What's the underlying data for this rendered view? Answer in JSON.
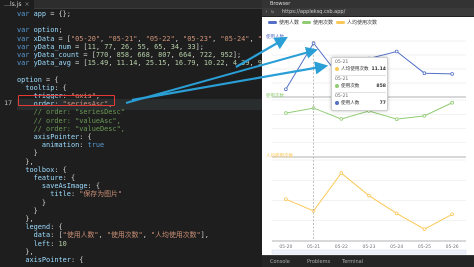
{
  "editor": {
    "tab_label": "…ls.js",
    "current_line": "17",
    "lines": [
      {
        "n": "",
        "html": "<span class=\"kw\">var</span> <span class=\"vr\">app</span> = {};"
      },
      {
        "n": "",
        "html": ""
      },
      {
        "n": "",
        "html": "<span class=\"kw\">var</span> <span class=\"vr\">option</span>;"
      },
      {
        "n": "",
        "html": "<span class=\"kw\">var</span> <span class=\"vr\">xData</span> = [<span class=\"st\">\"05-20\"</span>, <span class=\"st\">\"05-21\"</span>, <span class=\"st\">\"05-22\"</span>, <span class=\"st\">\"05-23\"</span>, <span class=\"st\">\"05-24\"</span>, <span class=\"st\">\"05-25\"</span>, <span class=\"st\">\"05-26\"</span>];"
      },
      {
        "n": "",
        "html": "<span class=\"kw\">var</span> <span class=\"vr\">yData_num</span> = [<span class=\"nm\">11</span>, <span class=\"nm\">77</span>, <span class=\"nm\">26</span>, <span class=\"nm\">55</span>, <span class=\"nm\">65</span>, <span class=\"nm\">34</span>, <span class=\"nm\">33</span>];"
      },
      {
        "n": "",
        "html": "<span class=\"kw\">var</span> <span class=\"vr\">yData_count</span> = [<span class=\"nm\">770</span>, <span class=\"nm\">858</span>, <span class=\"nm\">668</span>, <span class=\"nm\">807</span>, <span class=\"nm\">664</span>, <span class=\"nm\">722</span>, <span class=\"nm\">952</span>];"
      },
      {
        "n": "",
        "html": "<span class=\"kw\">var</span> <span class=\"vr\">yData_avg</span> = [<span class=\"nm\">15.49</span>, <span class=\"nm\">11.14</span>, <span class=\"nm\">25.15</span>, <span class=\"nm\">16.79</span>, <span class=\"nm\">10.22</span>, <span class=\"nm\">4.39</span>, <span class=\"nm\">9.9</span>];"
      },
      {
        "n": "",
        "html": ""
      },
      {
        "n": "",
        "html": "<span class=\"vr\">option</span> = {"
      },
      {
        "n": "",
        "html": "  <span class=\"vr\">tooltip</span>: {"
      },
      {
        "n": "",
        "html": "    <span class=\"vr\">trigger</span>: <span class=\"st\">\"axis\"</span>,"
      },
      {
        "n": "17",
        "html": "    <span class=\"vr\">order</span>: <span class=\"st\">\"seriesAsc\"</span>,",
        "hl": true
      },
      {
        "n": "",
        "html": "    <span class=\"cm\">// order: \"seriesDesc\"</span>"
      },
      {
        "n": "",
        "html": "    <span class=\"cm\">// order: \"valueAsc\",</span>"
      },
      {
        "n": "",
        "html": "    <span class=\"cm\">// order: \"valueDesc\",</span>"
      },
      {
        "n": "",
        "html": "    <span class=\"vr\">axisPointer</span>: {"
      },
      {
        "n": "",
        "html": "      <span class=\"vr\">animation</span>: <span class=\"bl\">true</span>"
      },
      {
        "n": "",
        "html": "    }"
      },
      {
        "n": "",
        "html": "  },"
      },
      {
        "n": "",
        "html": "  <span class=\"vr\">toolbox</span>: {"
      },
      {
        "n": "",
        "html": "    <span class=\"vr\">feature</span>: {"
      },
      {
        "n": "",
        "html": "      <span class=\"vr\">saveAsImage</span>: {"
      },
      {
        "n": "",
        "html": "        <span class=\"vr\">title</span>: <span class=\"st\">\"保存为图片\"</span>"
      },
      {
        "n": "",
        "html": "      }"
      },
      {
        "n": "",
        "html": "    }"
      },
      {
        "n": "",
        "html": "  },"
      },
      {
        "n": "",
        "html": "  <span class=\"vr\">legend</span>: {"
      },
      {
        "n": "",
        "html": "    <span class=\"vr\">data</span>: [<span class=\"st\">\"使用人数\"</span>, <span class=\"st\">\"使用次数\"</span>, <span class=\"st\">\"人均使用次数\"</span>],"
      },
      {
        "n": "",
        "html": "    <span class=\"vr\">left</span>: <span class=\"nm\">10</span>"
      },
      {
        "n": "",
        "html": "  },"
      },
      {
        "n": "",
        "html": "  <span class=\"vr\">axisPointer</span>: {"
      }
    ]
  },
  "browser": {
    "panel_title": "Browser",
    "url": "https://appleksq.csb.app/",
    "status_left": "Console",
    "status_mid": "Problems",
    "status_right": "Terminal"
  },
  "chart_data": [
    {
      "type": "line",
      "legend": [
        "使用人数",
        "使用次数",
        "人均使用次数"
      ],
      "categories": [
        "05-20",
        "05-21",
        "05-22",
        "05-23",
        "05-24",
        "05-25",
        "05-26"
      ],
      "grids": [
        {
          "title": "使用人数",
          "series": "使用人数",
          "values": [
            11,
            77,
            26,
            55,
            65,
            34,
            33
          ],
          "ylim": [
            0,
            80
          ],
          "color": "#5470c6"
        },
        {
          "title": "使用次数",
          "series": "使用次数",
          "values": [
            770,
            858,
            668,
            807,
            664,
            722,
            952
          ],
          "ylim": [
            0,
            1000
          ],
          "color": "#91cc75"
        },
        {
          "title": "人均使用次数",
          "series": "人均使用次数",
          "values": [
            15.49,
            11.14,
            25.15,
            16.79,
            10.22,
            4.39,
            9.9
          ],
          "ylim": [
            0,
            30
          ],
          "color": "#fac858"
        }
      ]
    }
  ],
  "tooltip": {
    "rows": [
      {
        "date": "05-21",
        "name": "人均使用次数",
        "value": "11.14",
        "color": "#fac858"
      },
      {
        "date": "05-21",
        "name": "使用次数",
        "value": "858",
        "color": "#91cc75"
      },
      {
        "date": "05-21",
        "name": "使用人数",
        "value": "77",
        "color": "#5470c6"
      }
    ]
  },
  "colors": {
    "annotation_arrow": "#2a9fd6",
    "highlight_box": "#e53935"
  }
}
